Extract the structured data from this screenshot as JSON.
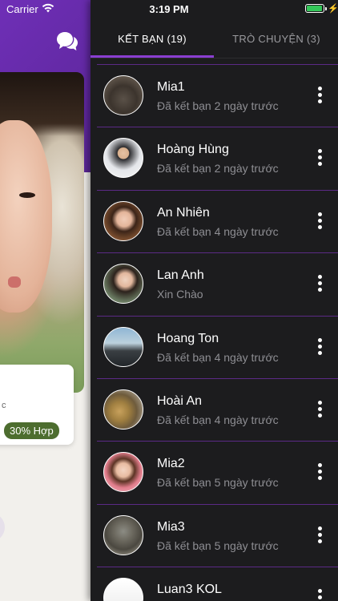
{
  "status_bar": {
    "carrier": "Carrier",
    "time": "3:19 PM",
    "wifi_icon": "wifi-icon",
    "battery_icon": "battery-icon",
    "battery_color": "#34c759"
  },
  "background_screen": {
    "header_color": "#6f2fb7",
    "chat_icon": "chat-bubble-icon",
    "partial_letter": "c",
    "match_badge": "30% Hợp",
    "match_badge_color": "#4d6d2f"
  },
  "tabs": [
    {
      "label": "KẾT BẠN (19)",
      "active": true
    },
    {
      "label": "TRÒ CHUYỆN (3)",
      "active": false
    }
  ],
  "accent_color": "#8a3fd1",
  "friends": [
    {
      "name": "Mia1",
      "status": "Đã kết bạn 2 ngày trước"
    },
    {
      "name": "Hoàng Hùng",
      "status": "Đã kết bạn 2 ngày trước"
    },
    {
      "name": "An Nhiên",
      "status": "Đã kết bạn 4 ngày trước"
    },
    {
      "name": "Lan Anh",
      "status": "Xin Chào"
    },
    {
      "name": "Hoang Ton",
      "status": "Đã kết bạn 4 ngày trước"
    },
    {
      "name": "Hoài An",
      "status": "Đã kết bạn 4 ngày trước"
    },
    {
      "name": "Mia2",
      "status": "Đã kết bạn 5 ngày trước"
    },
    {
      "name": "Mia3",
      "status": "Đã kết bạn 5 ngày trước"
    },
    {
      "name": "Luan3 KOL",
      "status": ""
    }
  ]
}
